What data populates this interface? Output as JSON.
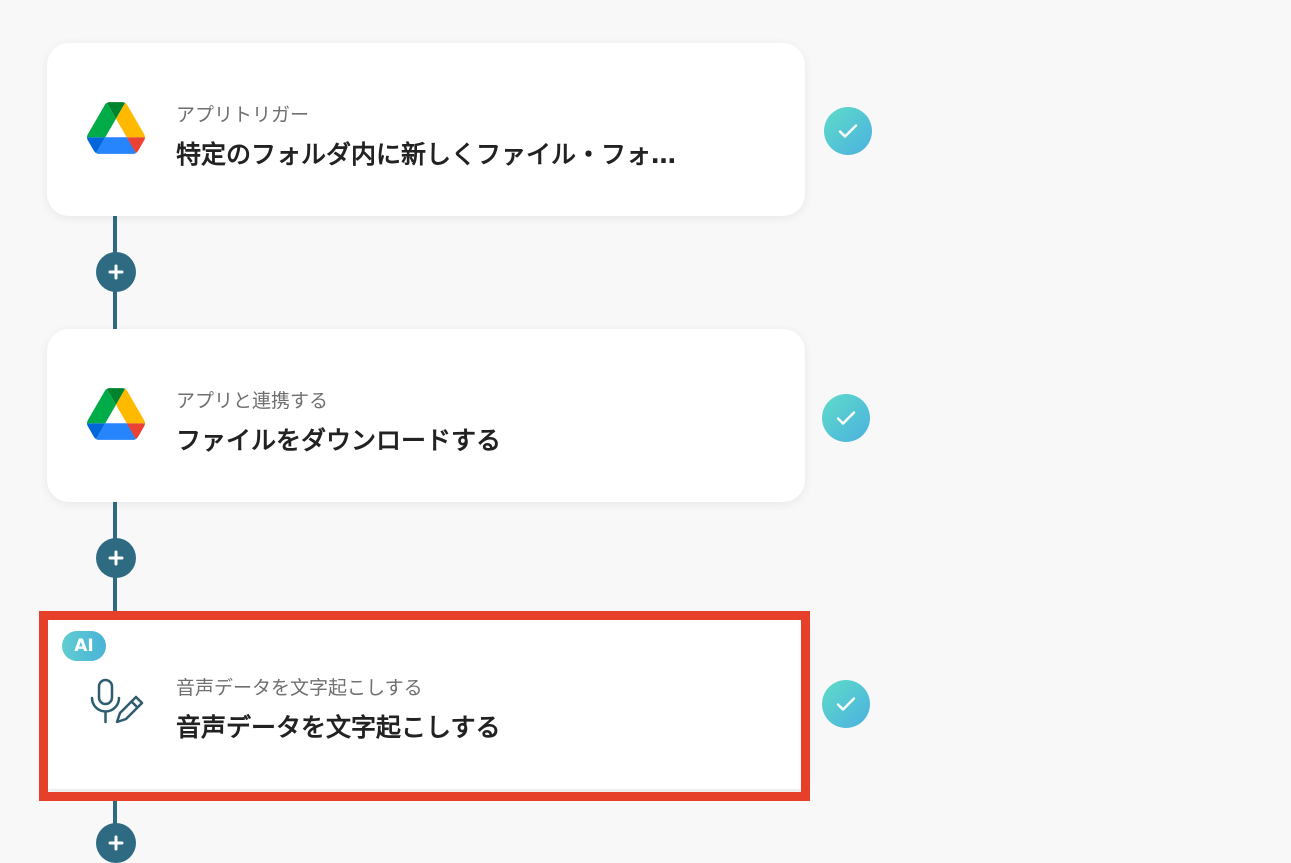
{
  "flow": {
    "steps": [
      {
        "subtitle": "アプリトリガー",
        "title": "特定のフォルダ内に新しくファイル・フォ…",
        "app_icon": "google-drive-icon",
        "status": "completed"
      },
      {
        "subtitle": "アプリと連携する",
        "title": "ファイルをダウンロードする",
        "app_icon": "google-drive-icon",
        "status": "completed"
      },
      {
        "badge": "AI",
        "subtitle": "音声データを文字起こしする",
        "title": "音声データを文字起こしする",
        "app_icon": "microphone-pen-icon",
        "status": "completed",
        "highlighted": true
      }
    ]
  },
  "colors": {
    "connector": "#2e6b82",
    "check_gradient_start": "#5fdcc8",
    "check_gradient_end": "#4bb0e0",
    "highlight_border": "#e6402b",
    "background": "#f8f8f8"
  }
}
